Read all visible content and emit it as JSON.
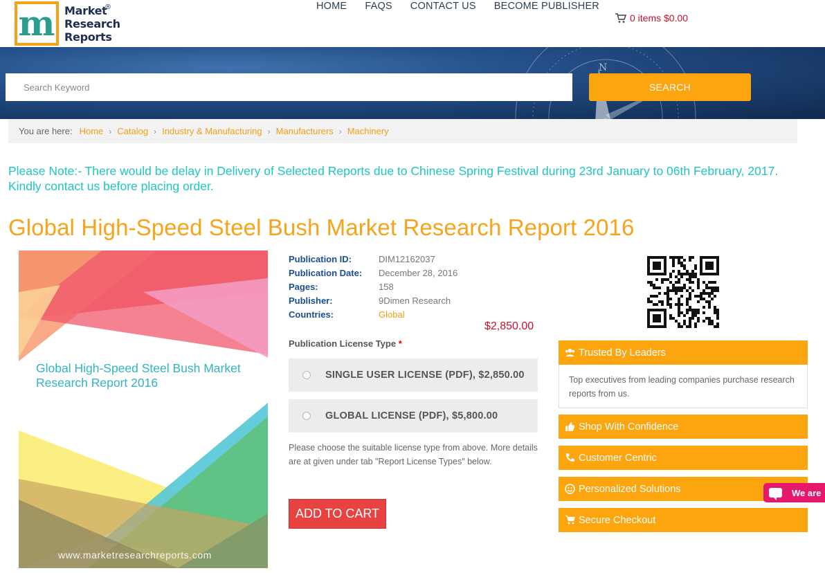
{
  "brand": {
    "line1": "Market",
    "line2": "Research",
    "line3": "Reports",
    "reg": "®",
    "logo_letter": "m"
  },
  "nav": {
    "home": "HOME",
    "faqs": "FAQS",
    "contact": "CONTACT US",
    "publisher": "BECOME PUBLISHER"
  },
  "cart": {
    "label": "0 items $0.00",
    "icon": "cart-icon"
  },
  "search": {
    "placeholder": "Search Keyword",
    "button": "SEARCH"
  },
  "breadcrumb": {
    "label": "You are here:",
    "items": [
      "Home",
      "Catalog",
      "Industry & Manufacturing",
      "Manufacturers",
      "Machinery"
    ]
  },
  "notice": "Please Note:- There would be delay in Delivery of Selected Reports due to Chinese Spring Festival during 23rd January to 06th February, 2017. Kindly contact us before placing order.",
  "title": "Global High-Speed Steel Bush Market Research Report 2016",
  "cover": {
    "title": "Global High-Speed Steel Bush Market Research Report 2016",
    "url": "www.marketresearchreports.com"
  },
  "meta": [
    {
      "key": "Publication ID:",
      "value": "DIM12162037"
    },
    {
      "key": "Publication Date:",
      "value": "December 28, 2016"
    },
    {
      "key": "Pages:",
      "value": "158"
    },
    {
      "key": "Publisher:",
      "value": "9Dimen Research"
    },
    {
      "key": "Countries:",
      "value": "Global"
    }
  ],
  "price": "$2,850.00",
  "license": {
    "label": "Publication License Type",
    "required": "*",
    "options": [
      "SINGLE USER LICENSE (PDF), $2,850.00",
      "GLOBAL LICENSE (PDF), $5,800.00"
    ],
    "note": "Please choose the suitable license type from above. More details are at given under tab \"Report License Types\" below."
  },
  "add_to_cart": "ADD TO CART",
  "sidebar": {
    "trusted": {
      "title": "Trusted By Leaders",
      "body": "Top executives from leading companies purchase research reports from us.",
      "icon": "users-icon"
    },
    "items": [
      {
        "title": "Shop With Confidence",
        "icon": "thumbs-up-icon"
      },
      {
        "title": "Customer Centric",
        "icon": "phone-icon"
      },
      {
        "title": "Personalized Solutions",
        "icon": "smile-icon"
      },
      {
        "title": "Secure Checkout",
        "icon": "cart-icon"
      }
    ]
  },
  "chat": {
    "label": "We are",
    "icon": "chat-icon"
  },
  "colors": {
    "accent": "#fda50f",
    "teal": "#1fc6c1",
    "title_orange": "#f7a31b",
    "price_red": "#c8102e",
    "add_cart_red": "#e84241",
    "meta_blue": "#1a4e93"
  }
}
